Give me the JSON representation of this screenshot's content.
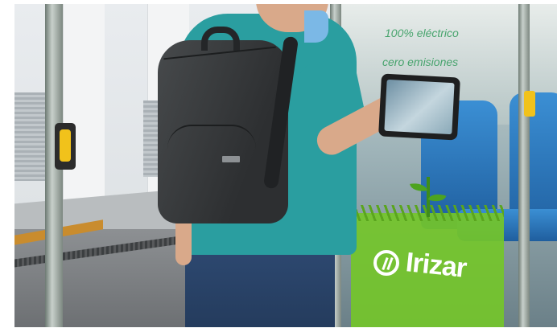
{
  "photo": {
    "door_text_line1": "100% eléctrico",
    "door_text_line2": "cero emisiones",
    "decal_brand": "Irizar",
    "brand_color": "#74c62a",
    "shirt_color": "#2a9ea0",
    "accent_button_color": "#f1c21b"
  }
}
